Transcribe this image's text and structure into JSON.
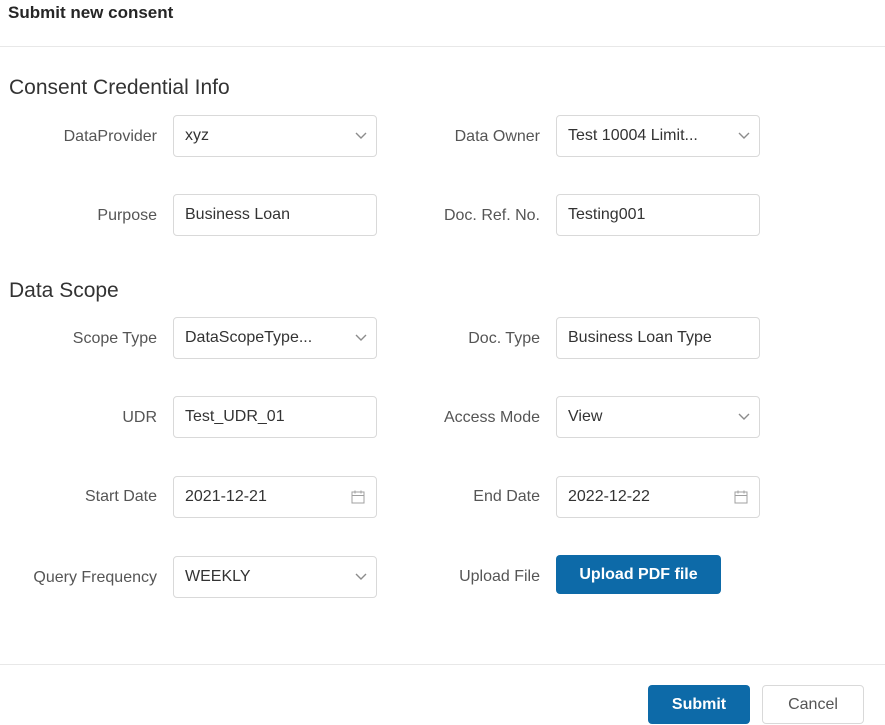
{
  "dialog": {
    "title": "Submit new consent"
  },
  "sections": {
    "credential": "Consent Credential Info",
    "scope": "Data Scope"
  },
  "fields": {
    "data_provider": {
      "label": "DataProvider",
      "value": "xyz"
    },
    "data_owner": {
      "label": "Data Owner",
      "value": "Test 10004 Limit..."
    },
    "purpose": {
      "label": "Purpose",
      "value": "Business Loan"
    },
    "doc_ref_no": {
      "label": "Doc. Ref. No.",
      "value": "Testing001"
    },
    "scope_type": {
      "label": "Scope Type",
      "value": "DataScopeType..."
    },
    "doc_type": {
      "label": "Doc. Type",
      "value": "Business Loan Type"
    },
    "udr": {
      "label": "UDR",
      "value": "Test_UDR_01"
    },
    "access_mode": {
      "label": "Access Mode",
      "value": "View"
    },
    "start_date": {
      "label": "Start Date",
      "value": "2021-12-21"
    },
    "end_date": {
      "label": "End Date",
      "value": "2022-12-22"
    },
    "query_frequency": {
      "label": "Query Frequency",
      "value": "WEEKLY"
    },
    "upload_file": {
      "label": "Upload File",
      "button": "Upload PDF file"
    }
  },
  "footer": {
    "submit": "Submit",
    "cancel": "Cancel"
  },
  "colors": {
    "primary": "#0d6aa8",
    "border": "#d9d9d9",
    "label": "#555555"
  },
  "icons": {
    "dropdown": "chevron-down-icon",
    "date": "calendar-icon"
  }
}
